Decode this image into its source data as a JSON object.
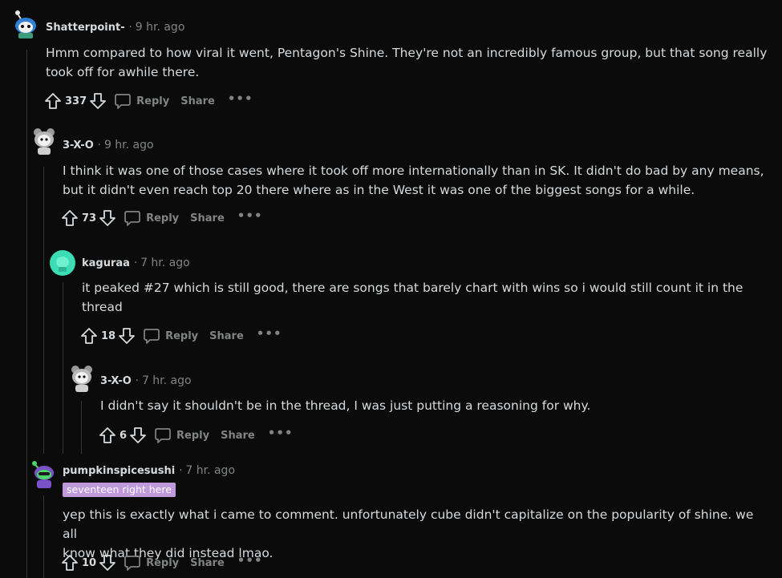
{
  "comments": [
    {
      "author": "Shatterpoint-",
      "time": "9 hr. ago",
      "body": [
        "Hmm compared to how viral it went, Pentagon's Shine. They're not an incredibly famous group, but that song really",
        "took off for awhile there."
      ],
      "votes": "337",
      "reply": "Reply",
      "share": "Share",
      "more": "•••"
    },
    {
      "author": "3-X-O",
      "time": "9 hr. ago",
      "body": [
        "I think it was one of those cases where it took off more internationally than in SK. It didn't do bad by any means,",
        "but it didn't even reach top 20 there where as in the West it was one of the biggest songs for a while."
      ],
      "votes": "73",
      "reply": "Reply",
      "share": "Share",
      "more": "•••"
    },
    {
      "author": "kaguraa",
      "time": "7 hr. ago",
      "body": [
        "it peaked #27 which is still good, there are songs that barely chart with wins so i would still count it in the",
        "thread"
      ],
      "votes": "18",
      "reply": "Reply",
      "share": "Share",
      "more": "•••"
    },
    {
      "author": "3-X-O",
      "time": "7 hr. ago",
      "body": [
        "I didn't say it shouldn't be in the thread, I was just putting a reasoning for why."
      ],
      "votes": "6",
      "reply": "Reply",
      "share": "Share",
      "more": "•••"
    },
    {
      "author": "pumpkinspicesushi",
      "time": "7 hr. ago",
      "flair": "seventeen right here",
      "body": [
        "yep this is exactly what i came to comment. unfortunately cube didn't capitalize on the popularity of shine. we all",
        "know what they did instead lmao."
      ],
      "votes": "10",
      "reply": "Reply",
      "share": "Share",
      "more": "•••"
    }
  ],
  "separator": "·",
  "icons": {
    "upvote": "upvote-icon",
    "downvote": "downvote-icon",
    "reply": "comment-bubble-icon",
    "avatar": "snoo-avatar-icon"
  },
  "colors": {
    "background": "#0b0b0b",
    "text": "#d7dadc",
    "meta": "#818384",
    "thread_line": "#343536",
    "flair_bg": "#c098dc",
    "kaguraa_avatar": "#3cdcb4",
    "pumpkin_avatar": "#7a52c7"
  }
}
